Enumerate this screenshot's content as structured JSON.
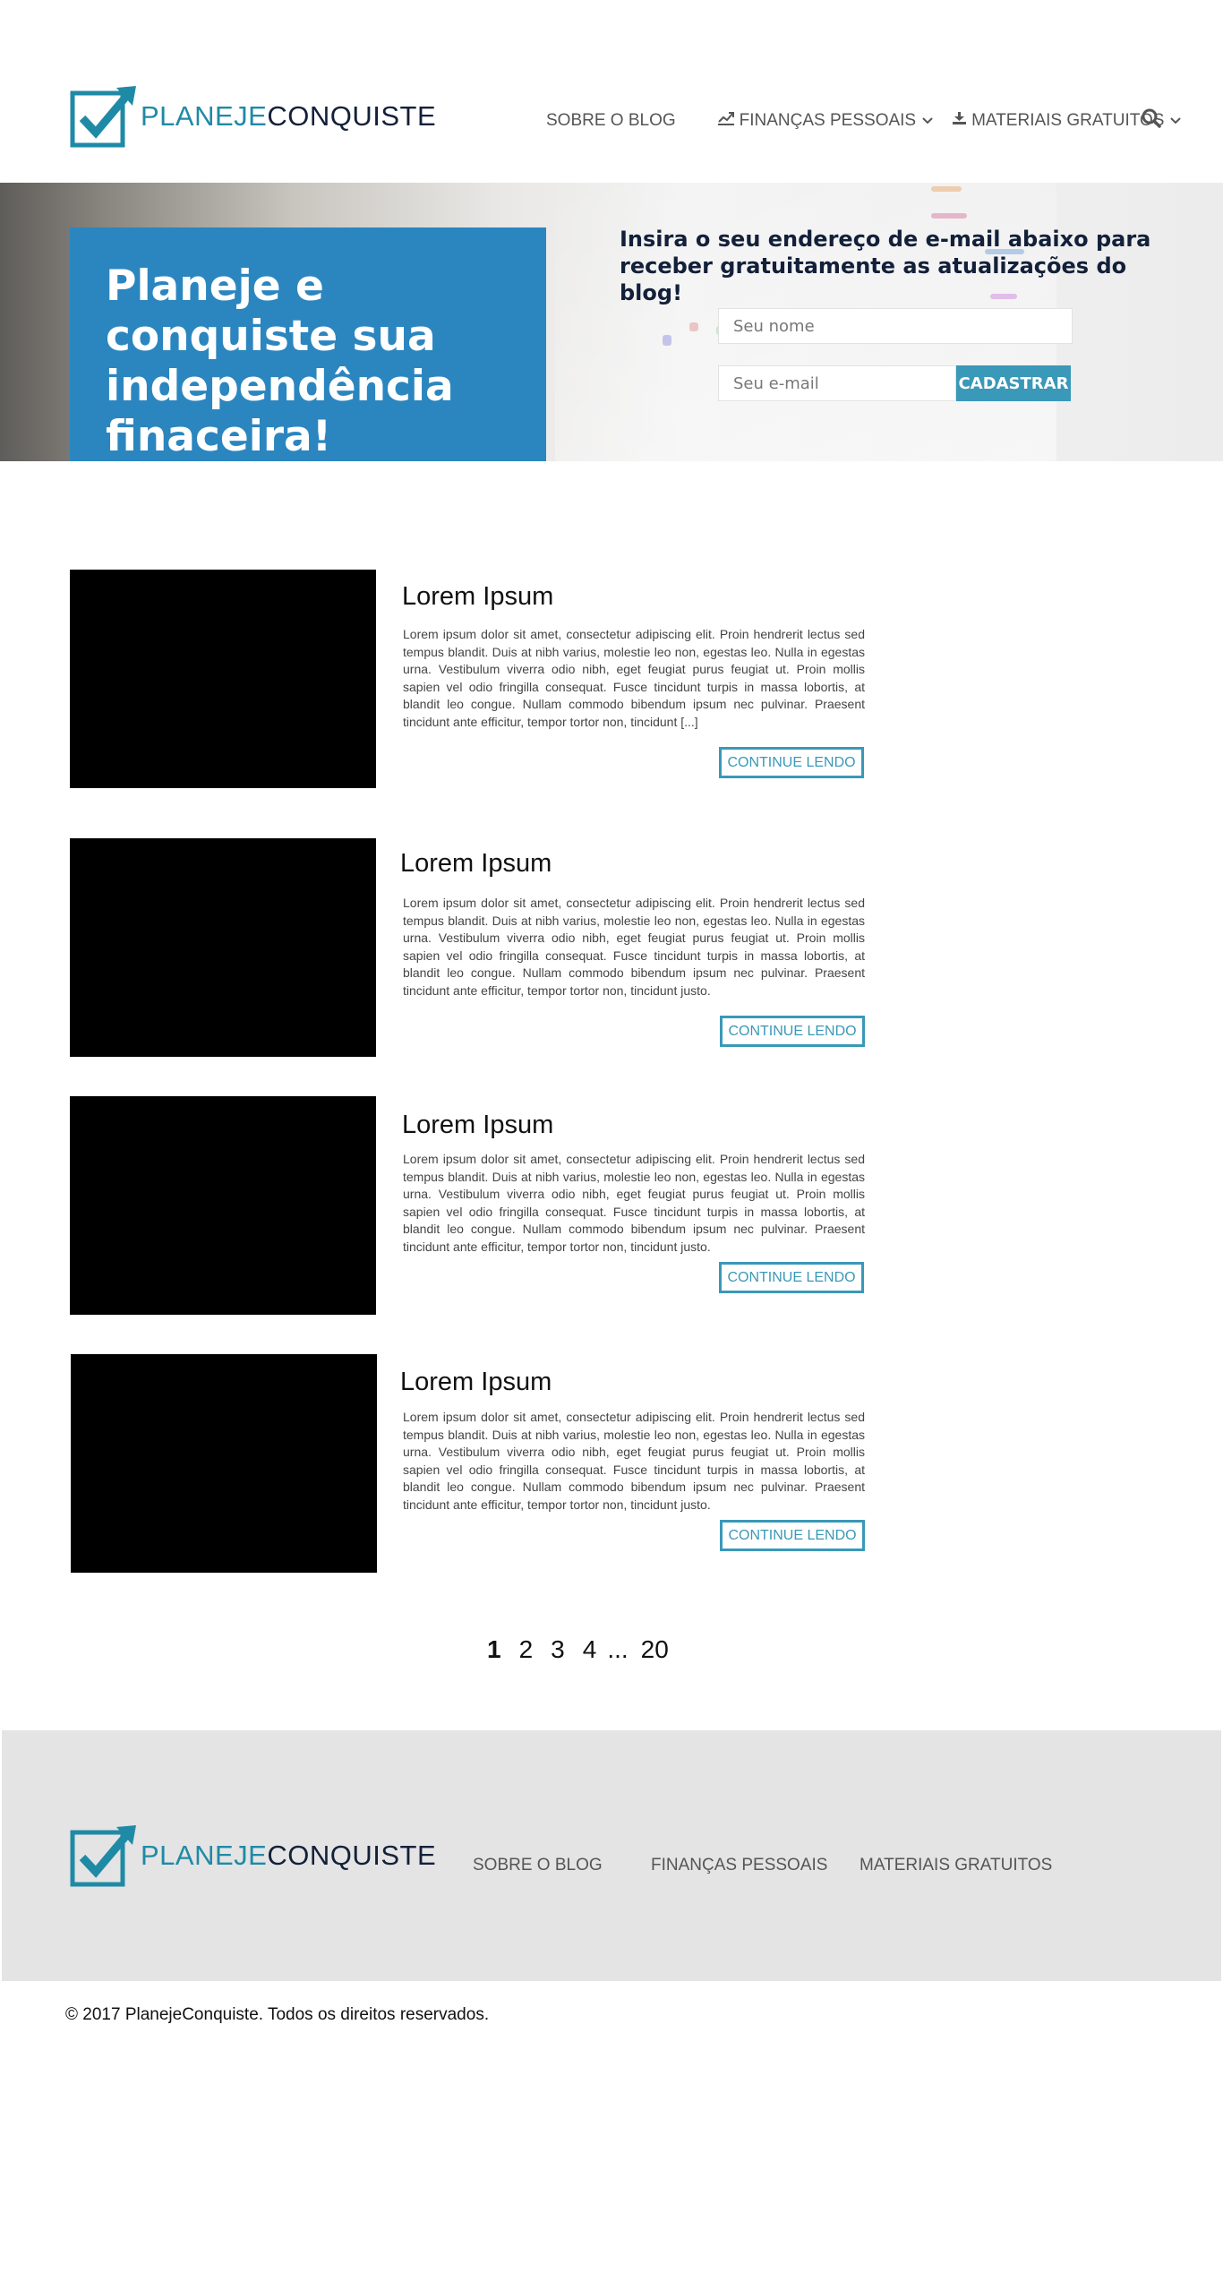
{
  "brand": {
    "logo_part1": "PLANEJE",
    "logo_part2": "CONQUISTE",
    "primary_color": "#1f8aa6",
    "dark_color": "#13203a",
    "accent_blue": "#2b86bf",
    "button_teal": "#3a98b8"
  },
  "header": {
    "nav": {
      "blog": "SOBRE O BLOG",
      "financas": "FINANÇAS PESSOAIS",
      "materiais": "MATERIAIS GRATUITOS"
    },
    "icons": {
      "financas": "chart-icon",
      "materiais": "download-icon",
      "chevron": "chevron-down-icon",
      "search": "search-icon"
    }
  },
  "hero": {
    "headline": "Planeje e conquiste sua independência finaceira!",
    "invite": "Insira o seu endereço de e-mail abaixo para receber gratuitamente as atualizações do blog!",
    "name_placeholder": "Seu nome",
    "email_placeholder": "Seu e-mail",
    "submit": "CADASTRAR"
  },
  "posts": [
    {
      "title": "Lorem Ipsum",
      "excerpt": "Lorem ipsum dolor sit amet, consectetur adipiscing elit. Proin hendrerit lectus sed tempus blandit. Duis at nibh varius, molestie leo non, egestas leo. Nulla in egestas urna. Vestibulum viverra odio nibh, eget feugiat purus feugiat ut. Proin mollis sapien vel odio fringilla consequat. Fusce tincidunt turpis in massa lobortis, at blandit leo congue. Nullam commodo bibendum ipsum nec pulvinar. Praesent tincidunt ante efficitur, tempor tortor non, tincidunt [...]",
      "more": "CONTINUE LENDO"
    },
    {
      "title": "Lorem Ipsum",
      "excerpt": "Lorem ipsum dolor sit amet, consectetur adipiscing elit. Proin hendrerit lectus sed tempus blandit. Duis at nibh varius, molestie leo non, egestas leo. Nulla in egestas urna. Vestibulum viverra odio nibh, eget feugiat purus feugiat ut. Proin mollis sapien vel odio fringilla consequat. Fusce tincidunt turpis in massa lobortis, at blandit leo congue. Nullam commodo bibendum ipsum nec pulvinar. Praesent tincidunt ante efficitur, tempor tortor non, tincidunt justo.",
      "more": "CONTINUE LENDO"
    },
    {
      "title": "Lorem Ipsum",
      "excerpt": "Lorem ipsum dolor sit amet, consectetur adipiscing elit. Proin hendrerit lectus sed tempus blandit. Duis at nibh varius, molestie leo non, egestas leo. Nulla in egestas urna. Vestibulum viverra odio nibh, eget feugiat purus feugiat ut. Proin mollis sapien vel odio fringilla consequat. Fusce tincidunt turpis in massa lobortis, at blandit leo congue. Nullam commodo bibendum ipsum nec pulvinar. Praesent tincidunt ante efficitur, tempor tortor non, tincidunt justo.",
      "more": "CONTINUE LENDO"
    },
    {
      "title": "Lorem Ipsum",
      "excerpt": "Lorem ipsum dolor sit amet, consectetur adipiscing elit. Proin hendrerit lectus sed tempus blandit. Duis at nibh varius, molestie leo non, egestas leo. Nulla in egestas urna. Vestibulum viverra odio nibh, eget feugiat purus feugiat ut. Proin mollis sapien vel odio fringilla consequat. Fusce tincidunt turpis in massa lobortis, at blandit leo congue. Nullam commodo bibendum ipsum nec pulvinar. Praesent tincidunt ante efficitur, tempor tortor non, tincidunt justo.",
      "more": "CONTINUE LENDO"
    }
  ],
  "pagination": {
    "pages": [
      "1",
      "2",
      "3",
      "4"
    ],
    "ellipsis": "...",
    "last": "20",
    "current": "1"
  },
  "footer": {
    "nav": {
      "blog": "SOBRE O BLOG",
      "financas": "FINANÇAS PESSOAIS",
      "materiais": "MATERIAIS GRATUITOS"
    },
    "copyright": "© 2017 PlanejeConquiste. Todos os direitos reservados."
  }
}
